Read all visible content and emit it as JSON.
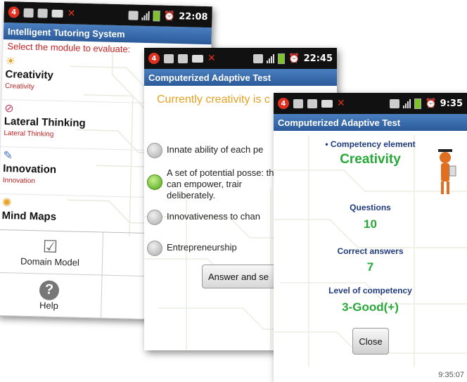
{
  "screen1": {
    "status_time": "22:08",
    "notification_count": "4",
    "app_title": "Intelligent Tutoring System",
    "prompt": "Select the module to evaluate:",
    "modules": [
      {
        "name": "Creativity",
        "subtitle": "Creativity",
        "icon": "sun-figure-icon"
      },
      {
        "name": "Lateral Thinking",
        "subtitle": "Lateral Thinking",
        "icon": "brain-icon"
      },
      {
        "name": "Innovation",
        "subtitle": "Innovation",
        "icon": "lightbulb-icon"
      },
      {
        "name": "Mind Maps",
        "subtitle": "",
        "icon": "mind-map-icon"
      }
    ],
    "grid_buttons": [
      {
        "label": "Domain Model",
        "icon": "clipboard-check-icon"
      },
      {
        "label": "Help",
        "icon": "question-icon"
      }
    ]
  },
  "screen2": {
    "status_time": "22:45",
    "notification_count": "4",
    "app_title": "Computerized Adaptive Test",
    "question": "Currently creativity is c as:",
    "options": [
      {
        "label": "Innate ability of each pe",
        "selected": false
      },
      {
        "label": "A set of potential posse: that can empower, trair deliberately.",
        "selected": true
      },
      {
        "label": "Innovativeness to chan",
        "selected": false
      },
      {
        "label": "Entrepreneurship",
        "selected": false
      }
    ],
    "answer_button": "Answer and se"
  },
  "screen3": {
    "status_time": "9:35",
    "notification_count": "4",
    "app_title": "Computerized Adaptive Test",
    "competency_label": "• Competency element",
    "competency_value": "Creativity",
    "questions_label": "Questions",
    "questions_value": "10",
    "correct_label": "Correct answers",
    "correct_value": "7",
    "level_label": "Level of competency",
    "level_value": "3-Good(+)",
    "close_button": "Close",
    "footer_time": "9:35:07",
    "colors": {
      "value_green": "#28a838",
      "label_blue": "#203a80"
    }
  }
}
